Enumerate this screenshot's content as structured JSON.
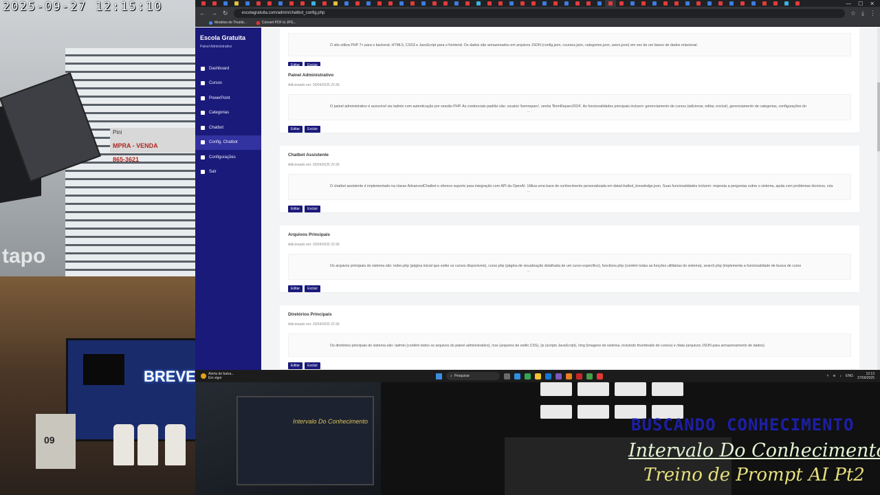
{
  "camera": {
    "timestamp": "2025-09-27 12:15:10",
    "watermark": "tapo",
    "sign_text": "Pini",
    "sign_red": "MPRA - VENDA",
    "sign_phone": "865-3621",
    "calendar_day": "09",
    "monitor_text": "BREVE!",
    "screen_text": "Intervalo Do Conhecimento"
  },
  "overlay": {
    "line1": "BUSCANDO CONHECIMENTO",
    "line2": "Intervalo Do Conhecimento",
    "line3": "Treino de Prompt AI Pt2"
  },
  "browser": {
    "url": "escolagratuita.com/admin/chatbot_config.php",
    "bookmarks": [
      "Modelos de Thumb...",
      "Convert PDF to JPG..."
    ],
    "tab_colors": [
      "#e23b3b",
      "#e23b3b",
      "#3b7de2",
      "#e2c23b",
      "#3b7de2",
      "#e23b3b",
      "#e23b3b",
      "#3b7de2",
      "#e23b3b",
      "#e23b3b",
      "#3bb0e2",
      "#e23b3b",
      "#e2c23b",
      "#3b7de2",
      "#e23b3b",
      "#3b7de2",
      "#e23b3b",
      "#e23b3b",
      "#3b7de2",
      "#e23b3b",
      "#3b7de2",
      "#e23b3b",
      "#e23b3b",
      "#3b7de2",
      "#e23b3b",
      "#3bb0e2",
      "#e23b3b",
      "#e23b3b",
      "#3b7de2",
      "#e23b3b",
      "#e23b3b",
      "#3b7de2",
      "#e23b3b",
      "#3b7de2",
      "#e23b3b",
      "#e23b3b",
      "#3b7de2",
      "#e23b3b",
      "#e23b3b",
      "#3b7de2",
      "#e23b3b",
      "#3b7de2",
      "#e23b3b",
      "#e23b3b",
      "#3b7de2",
      "#e23b3b",
      "#3b7de2",
      "#e23b3b",
      "#3b7de2",
      "#e23b3b",
      "#3b7de2",
      "#e23b3b",
      "#e23b3b",
      "#3bb0e2",
      "#e23b3b"
    ]
  },
  "sidebar": {
    "title": "Escola Gratuita",
    "subtitle": "Painel Administrativo",
    "items": [
      {
        "label": "Dashboard",
        "active": false
      },
      {
        "label": "Cursos",
        "active": false
      },
      {
        "label": "PowerPoint",
        "active": false
      },
      {
        "label": "Categorias",
        "active": false
      },
      {
        "label": "Chatbot",
        "active": false
      },
      {
        "label": "Config. Chatbot",
        "active": true
      },
      {
        "label": "Configurações",
        "active": false
      },
      {
        "label": "Sair",
        "active": false
      }
    ]
  },
  "entries": [
    {
      "title": "",
      "date": "",
      "text": "O site utiliza PHP 7+ para o backend, HTML5, CSS3 e JavaScript para o frontend. Os dados são armazenados em arquivos JSON (config.json, courses.json, categories.json, users.json) em vez de um banco de dados relacional.",
      "ellipsis": ""
    },
    {
      "title": "Painel Administrativo",
      "date": "Adicionado em: 20/04/2025 22:36",
      "text": "O painel administrativo é acessível via /admin com autenticação por sessão PHP. As credenciais padrão são: usuário 'bomreparo', senha 'BomReparo2024'. As funcionalidades principais incluem: gerenciamento de cursos (adicionar, editar, excluir), gerenciamento de categorias, configurações do",
      "ellipsis": "..."
    },
    {
      "title": "Chatbot Assistente",
      "date": "Adicionado em: 20/04/2025 22:36",
      "text": "O chatbot assistente é implementado na classe AdvancedChatbot e oferece suporte para integração com API da OpenAI. Utiliza uma base de conhecimento personalizada em data/chatbot_knowledge.json. Suas funcionalidades incluem: resposta a perguntas sobre o sistema, ajuda com problemas técnicos, cria",
      "ellipsis": "..."
    },
    {
      "title": "Arquivos Principais",
      "date": "Adicionado em: 20/04/2025 22:36",
      "text": "Os arquivos principais do sistema são: index.php (página inicial que exibe os cursos disponíveis), curso.php (página de visualização detalhada de um curso específico), functions.php (contém todas as funções utilitárias do sistema), search.php (implementa a funcionalidade de busca de curso",
      "ellipsis": "..."
    },
    {
      "title": "Diretórios Principais",
      "date": "Adicionado em: 20/04/2025 22:36",
      "text": "Os diretórios principais do sistema são: /admin (contém todos os arquivos do painel administrativo), /css (arquivos de estilo CSS), /js (scripts JavaScript), /img (imagens do sistema, incluindo thumbnails de cursos) e /data (arquivos JSON para armazenamento de dados).",
      "ellipsis": ""
    }
  ],
  "buttons": {
    "edit": "Editar",
    "delete": "Excluir"
  },
  "taskbar": {
    "alert_title": "Alerta de baixa...",
    "alert_sub": "Em vigor",
    "search_placeholder": "Pesquisar",
    "lang": "ENG",
    "time": "12:13",
    "date": "27/09/2025"
  }
}
